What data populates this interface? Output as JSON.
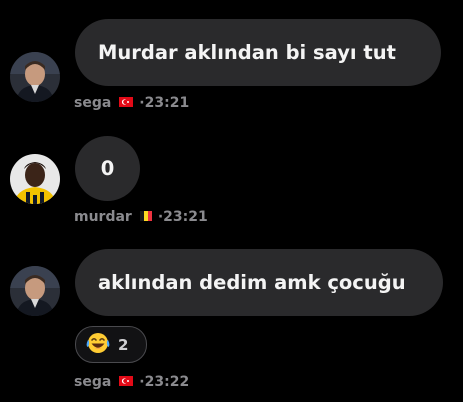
{
  "messages": [
    {
      "text": "Murdar aklından bi sayı tut",
      "sender": "sega",
      "flag": "turkey-flag",
      "time": "·23:21"
    },
    {
      "text": "0",
      "sender": "murdar",
      "flag": "belgium-flag",
      "time": "·23:21"
    },
    {
      "text": "aklından dedim amk çocuğu",
      "sender": "sega",
      "flag": "turkey-flag",
      "time": "·23:22",
      "reaction": {
        "emoji": "laughing-crying-emoji",
        "count": "2"
      }
    }
  ],
  "colors": {
    "background": "#000000",
    "bubble": "#2a2a2c",
    "meta_text": "#8a8a8e",
    "turkey_red": "#e30a17",
    "belgium_black": "#000000",
    "belgium_yellow": "#fdda24",
    "belgium_red": "#ef3340"
  }
}
